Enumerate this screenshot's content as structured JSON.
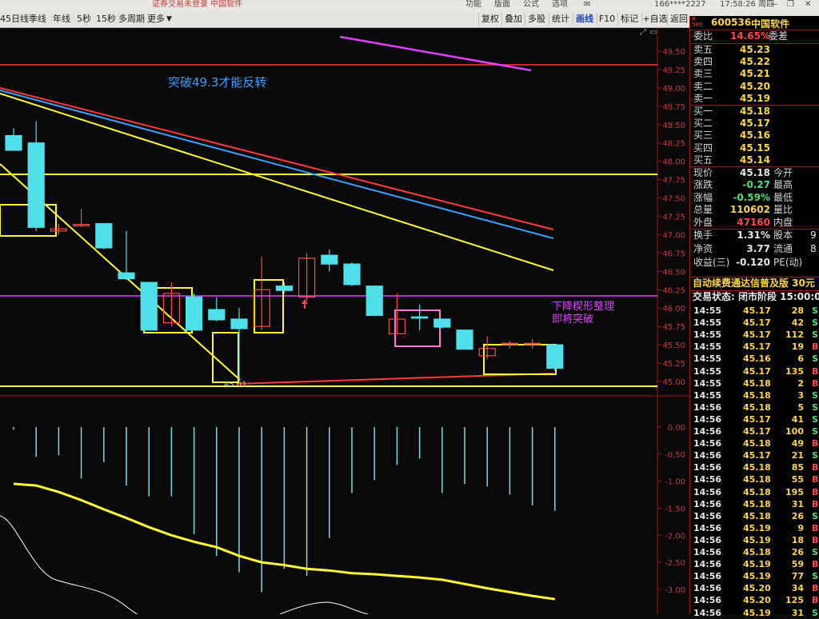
{
  "top_bar": {
    "left_text": "证券交易未登录 中国软件",
    "menu": [
      "功能",
      "版面",
      "公式",
      "选项"
    ],
    "account": "166****2227",
    "datetime": "17:58:26 周四"
  },
  "periods": [
    "45日线",
    "季线",
    "年线",
    "5秒",
    "15秒",
    "多周期",
    "更多"
  ],
  "toolbar_buttons": [
    "复权",
    "叠加",
    "多股",
    "统计",
    "画线",
    "F10",
    "标记",
    "+自选",
    "返回"
  ],
  "chart": {
    "price_ticks": [
      "49.50",
      "49.25",
      "49.00",
      "48.75",
      "48.50",
      "48.25",
      "48.00",
      "47.75",
      "47.50",
      "47.25",
      "47.00",
      "46.75",
      "46.50",
      "46.25",
      "46.00",
      "45.75",
      "45.50",
      "45.25",
      "45.00"
    ],
    "indicator_ticks": [
      "0.00",
      "-0.50",
      "-1.00",
      "-1.50",
      "-2.00",
      "-2.50",
      "-3.00"
    ],
    "low_label": "45.01",
    "annotation1": "突破49.3才能反转",
    "annotation2_line1": "下降楔形整理",
    "annotation2_line2": "即将突破"
  },
  "chart_data": {
    "type": "candlestick",
    "title": "",
    "ylim": [
      45.0,
      49.5
    ],
    "candles": [
      {
        "o": 48.35,
        "h": 48.45,
        "l": 48.15,
        "c": 48.15
      },
      {
        "o": 48.25,
        "h": 48.55,
        "l": 47.05,
        "c": 47.1
      },
      {
        "o": 47.05,
        "h": 47.15,
        "l": 47.0,
        "c": 47.08
      },
      {
        "o": 47.12,
        "h": 47.35,
        "l": 47.1,
        "c": 47.14
      },
      {
        "o": 47.15,
        "h": 47.15,
        "l": 46.8,
        "c": 46.82
      },
      {
        "o": 46.48,
        "h": 47.05,
        "l": 46.38,
        "c": 46.4
      },
      {
        "o": 46.35,
        "h": 46.35,
        "l": 45.7,
        "c": 45.7
      },
      {
        "o": 45.8,
        "h": 46.35,
        "l": 45.75,
        "c": 46.2
      },
      {
        "o": 46.15,
        "h": 46.2,
        "l": 45.7,
        "c": 45.7
      },
      {
        "o": 45.98,
        "h": 46.15,
        "l": 45.82,
        "c": 45.84
      },
      {
        "o": 45.85,
        "h": 46.0,
        "l": 45.01,
        "c": 45.72
      },
      {
        "o": 45.75,
        "h": 46.7,
        "l": 45.7,
        "c": 46.25
      },
      {
        "o": 46.3,
        "h": 46.35,
        "l": 46.2,
        "c": 46.24
      },
      {
        "o": 46.15,
        "h": 46.75,
        "l": 46.1,
        "c": 46.68
      },
      {
        "o": 46.72,
        "h": 46.8,
        "l": 46.5,
        "c": 46.6
      },
      {
        "o": 46.6,
        "h": 46.62,
        "l": 46.3,
        "c": 46.32
      },
      {
        "o": 46.3,
        "h": 46.3,
        "l": 45.9,
        "c": 45.9
      },
      {
        "o": 45.65,
        "h": 46.2,
        "l": 45.65,
        "c": 45.85
      },
      {
        "o": 45.88,
        "h": 46.05,
        "l": 45.7,
        "c": 45.88
      },
      {
        "o": 45.85,
        "h": 45.85,
        "l": 45.72,
        "c": 45.74
      },
      {
        "o": 45.7,
        "h": 45.7,
        "l": 45.45,
        "c": 45.44
      },
      {
        "o": 45.35,
        "h": 45.62,
        "l": 45.3,
        "c": 45.45
      },
      {
        "o": 45.5,
        "h": 45.55,
        "l": 45.45,
        "c": 45.52
      },
      {
        "o": 45.5,
        "h": 45.58,
        "l": 45.45,
        "c": 45.52
      },
      {
        "o": 45.5,
        "h": 45.5,
        "l": 45.15,
        "c": 45.18
      }
    ],
    "macd_bars": [
      -0.05,
      -0.55,
      -0.52,
      -0.95,
      -0.65,
      -1.08,
      -1.28,
      -1.28,
      -1.98,
      -2.38,
      -2.68,
      -3.05,
      -2.62,
      -2.75,
      -2.05,
      -1.22,
      -0.98,
      -0.7,
      -0.58,
      -1.22,
      -1.05,
      -1.1,
      -1.25,
      -1.45,
      -1.55
    ],
    "macd_line": [
      -1.05,
      -1.08,
      -1.2,
      -1.35,
      -1.52,
      -1.68,
      -1.85,
      -2.0,
      -2.12,
      -2.22,
      -2.38,
      -2.5,
      -2.55,
      -2.62,
      -2.65,
      -2.7,
      -2.72,
      -2.75,
      -2.78,
      -2.82,
      -2.9,
      -2.98,
      -3.05,
      -3.12,
      -3.18
    ]
  },
  "side": {
    "stock_code": "600536",
    "stock_name": "中国软件",
    "weibi_label": "委比",
    "weibi_value": "14.65%",
    "weicha_label": "委差",
    "asks": [
      {
        "label": "卖五",
        "price": "45.23"
      },
      {
        "label": "卖四",
        "price": "45.22"
      },
      {
        "label": "卖三",
        "price": "45.21"
      },
      {
        "label": "卖二",
        "price": "45.20"
      },
      {
        "label": "卖一",
        "price": "45.19"
      }
    ],
    "bids": [
      {
        "label": "买一",
        "price": "45.18"
      },
      {
        "label": "买二",
        "price": "45.17"
      },
      {
        "label": "买三",
        "price": "45.16"
      },
      {
        "label": "买四",
        "price": "45.15"
      },
      {
        "label": "买五",
        "price": "45.14"
      }
    ],
    "quote": [
      {
        "label": "现价",
        "value": "45.18",
        "color": "white",
        "label2": "今开"
      },
      {
        "label": "涨跌",
        "value": "-0.27",
        "color": "green",
        "label2": "最高"
      },
      {
        "label": "涨幅",
        "value": "-0.59%",
        "color": "green",
        "label2": "最低"
      },
      {
        "label": "总量",
        "value": "110602",
        "color": "yellow",
        "label2": "量比"
      },
      {
        "label": "外盘",
        "value": "47160",
        "color": "red",
        "label2": "内盘"
      }
    ],
    "stats": [
      {
        "label": "换手",
        "value": "1.31%",
        "label2": "股本",
        "value2": "9"
      },
      {
        "label": "净资",
        "value": "3.77",
        "label2": "流通",
        "value2": "8"
      },
      {
        "label": "收益(三)",
        "value": "-0.120",
        "label2": "PE(动)",
        "value2": ""
      }
    ],
    "promo": "自动续费通达信普及版 30元",
    "trade_status": "交易状态: 闭市阶段 15:00:0",
    "ticks": [
      {
        "t": "14:55",
        "p": "45.17",
        "v": "28",
        "s": "S"
      },
      {
        "t": "14:55",
        "p": "45.17",
        "v": "42",
        "s": "S"
      },
      {
        "t": "14:55",
        "p": "45.17",
        "v": "112",
        "s": "S"
      },
      {
        "t": "14:55",
        "p": "45.17",
        "v": "19",
        "s": "B"
      },
      {
        "t": "14:55",
        "p": "45.16",
        "v": "6",
        "s": "S"
      },
      {
        "t": "14:55",
        "p": "45.17",
        "v": "135",
        "s": "B"
      },
      {
        "t": "14:55",
        "p": "45.18",
        "v": "2",
        "s": "B"
      },
      {
        "t": "14:55",
        "p": "45.18",
        "v": "3",
        "s": "S"
      },
      {
        "t": "14:56",
        "p": "45.18",
        "v": "5",
        "s": "S"
      },
      {
        "t": "14:56",
        "p": "45.17",
        "v": "41",
        "s": "S"
      },
      {
        "t": "14:56",
        "p": "45.17",
        "v": "100",
        "s": "S"
      },
      {
        "t": "14:56",
        "p": "45.18",
        "v": "49",
        "s": "B"
      },
      {
        "t": "14:56",
        "p": "45.17",
        "v": "21",
        "s": "S"
      },
      {
        "t": "14:56",
        "p": "45.18",
        "v": "85",
        "s": "B"
      },
      {
        "t": "14:56",
        "p": "45.18",
        "v": "55",
        "s": "B"
      },
      {
        "t": "14:56",
        "p": "45.18",
        "v": "195",
        "s": "B"
      },
      {
        "t": "14:56",
        "p": "45.18",
        "v": "31",
        "s": "B"
      },
      {
        "t": "14:56",
        "p": "45.18",
        "v": "26",
        "s": "S"
      },
      {
        "t": "14:56",
        "p": "45.19",
        "v": "9",
        "s": "B"
      },
      {
        "t": "14:56",
        "p": "45.19",
        "v": "18",
        "s": "B"
      },
      {
        "t": "14:56",
        "p": "45.18",
        "v": "26",
        "s": "S"
      },
      {
        "t": "14:56",
        "p": "45.19",
        "v": "59",
        "s": "B"
      },
      {
        "t": "14:56",
        "p": "45.19",
        "v": "77",
        "s": "S"
      },
      {
        "t": "14:56",
        "p": "45.20",
        "v": "34",
        "s": "B"
      },
      {
        "t": "14:56",
        "p": "45.20",
        "v": "125",
        "s": "B"
      },
      {
        "t": "14:56",
        "p": "45.19",
        "v": "31",
        "s": "S"
      }
    ]
  },
  "colors": {
    "up": "#ff4a4a",
    "down": "#4fe0ea",
    "ma_yellow": "#ffff33",
    "trend_red": "#ff3b3b",
    "trend_blue": "#3aa0ff",
    "magenta": "#e040ff",
    "axis_red": "#a01818"
  }
}
